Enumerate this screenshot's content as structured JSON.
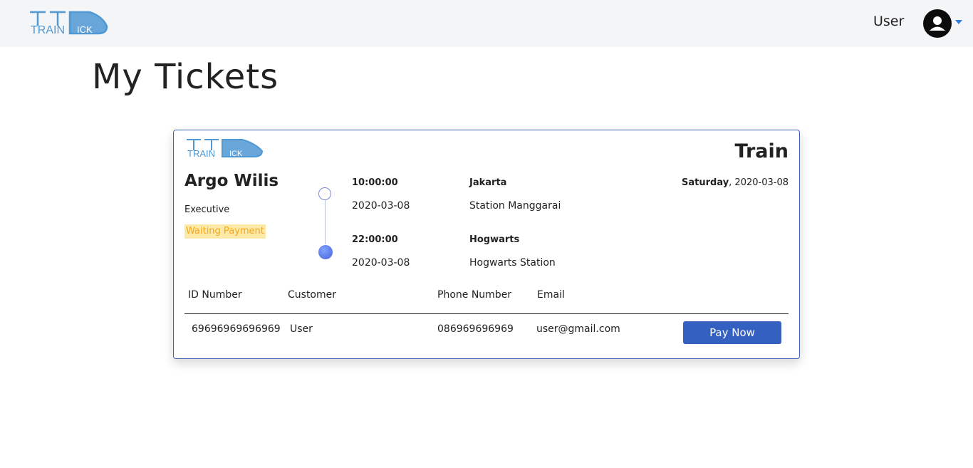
{
  "header": {
    "brand": "TRAINTICK",
    "user_label": "User",
    "avatar_icon": "user-circle-icon",
    "caret_icon": "caret-down-icon",
    "colors": {
      "navbar_bg": "#f4f5f7",
      "logo_blue": "#4f98d3",
      "caret": "#2f7fe0"
    }
  },
  "page": {
    "title": "My Tickets"
  },
  "ticket": {
    "brand": "TRAINTICK",
    "transport_type": "Train",
    "train_name": "Argo Wilis",
    "class": "Executive",
    "status": "Waiting Payment",
    "departure": {
      "time": "10:00:00",
      "date": "2020-03-08",
      "city": "Jakarta",
      "station": "Station Manggarai"
    },
    "arrival": {
      "time": "22:00:00",
      "date": "2020-03-08",
      "city": "Hogwarts",
      "station": "Hogwarts Station"
    },
    "travel_day": "Saturday",
    "travel_date": ", 2020-03-08",
    "table": {
      "headers": [
        "ID Number",
        "Customer",
        "Phone Number",
        "Email"
      ],
      "row": {
        "id_number": "69696969696969",
        "customer": "User",
        "phone": "086969696969",
        "email": "user@gmail.com"
      }
    },
    "pay_button": "Pay Now",
    "colors": {
      "card_border": "#3d63b8",
      "status_bg": "#fde9a8",
      "status_text": "#f2a81c",
      "button_bg": "#3461c1"
    }
  }
}
